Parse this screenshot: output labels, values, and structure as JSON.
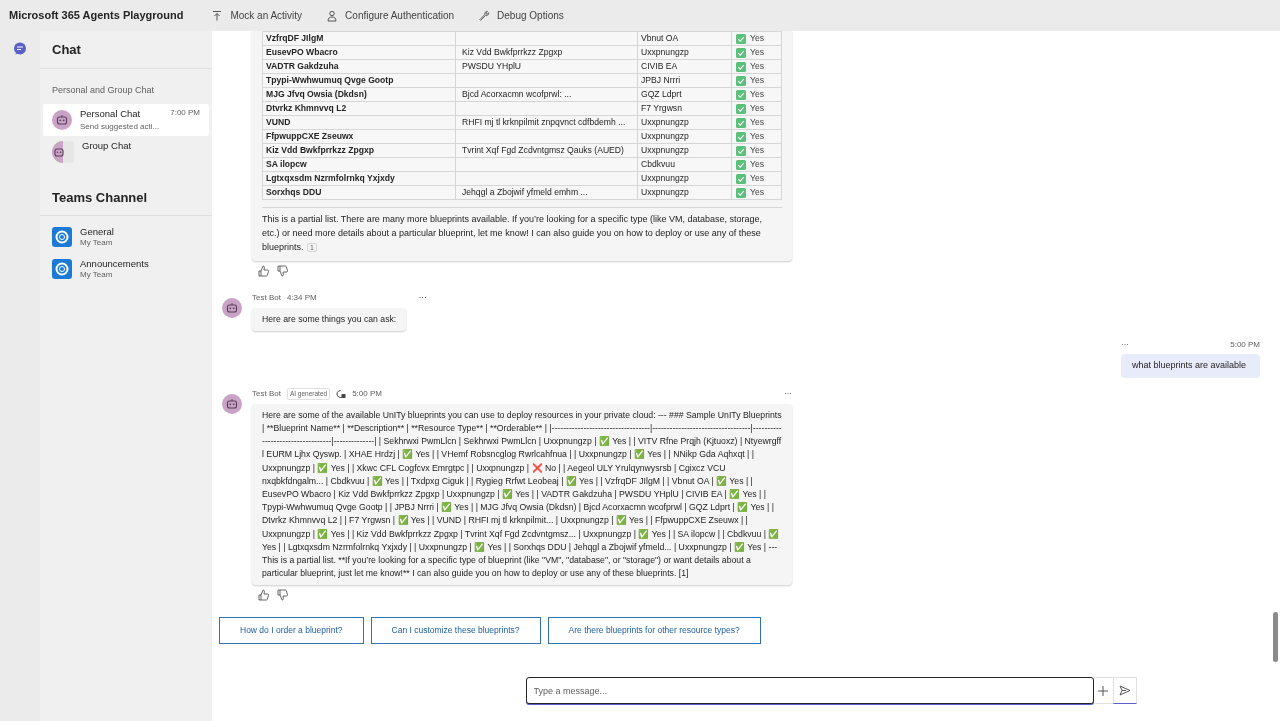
{
  "app_title": "Microsoft 365 Agents Playground",
  "toolbar": [
    {
      "kind": "upload",
      "label": "Mock an Activity"
    },
    {
      "kind": "person",
      "label": "Configure Authentication"
    },
    {
      "kind": "wrench",
      "label": "Debug Options"
    }
  ],
  "sidebar": {
    "title": "Chat",
    "section": "Personal and Group Chat",
    "chats": [
      {
        "kind": "bot",
        "name": "Personal Chat",
        "time": "7:00 PM",
        "preview": "Send suggested acti...",
        "selected": true
      },
      {
        "kind": "group",
        "name": "Group Chat",
        "selected": false
      }
    ],
    "teams_title": "Teams Channel",
    "channels": [
      {
        "name": "General",
        "team": "My Team"
      },
      {
        "name": "Announcements",
        "team": "My Team"
      }
    ]
  },
  "blueprint_table": {
    "rows": [
      {
        "name": "VzfrqDF JIlgM",
        "description": "",
        "type": "Vbnut OA",
        "orderable": "Yes",
        "ok": true
      },
      {
        "name": "EusevPO Wbacro",
        "description": "Kiz Vdd Bwkfprrkzz Zpgxp",
        "type": "Uxxpnungzp",
        "orderable": "Yes",
        "ok": true
      },
      {
        "name": "VADTR Gakdzuha",
        "description": "PWSDU YHplU",
        "type": "CIVIB EA",
        "orderable": "Yes",
        "ok": true
      },
      {
        "name": "Tpypi-Wwhwumuq Qvge Gootp",
        "description": "",
        "type": "JPBJ Nrrri",
        "orderable": "Yes",
        "ok": true
      },
      {
        "name": "MJG Jfvq Owsia (Dkdsn)",
        "description": "Bjcd Acorxacmn wcofprwl: ...",
        "type": "GQZ Ldprt",
        "orderable": "Yes",
        "ok": true
      },
      {
        "name": "Dtvrkz Khmnvvq L2",
        "description": "",
        "type": "F7 Yrgwsn",
        "orderable": "Yes",
        "ok": true
      },
      {
        "name": "VUND",
        "description": "RHFI mj tl krknpilmit znpqvnct cdfbdemh ...",
        "type": "Uxxpnungzp",
        "orderable": "Yes",
        "ok": true
      },
      {
        "name": "FfpwuppCXE Zseuwx",
        "description": "",
        "type": "Uxxpnungzp",
        "orderable": "Yes",
        "ok": true
      },
      {
        "name": "Kiz Vdd Bwkfprrkzz Zpgxp",
        "description": "Tvrint Xqf Fgd Zcdvntgmsz Qauks (AUED)",
        "type": "Uxxpnungzp",
        "orderable": "Yes",
        "ok": true
      },
      {
        "name": "SA ilopcw",
        "description": "",
        "type": "Cbdkvuu",
        "orderable": "Yes",
        "ok": true
      },
      {
        "name": "Lgtxqxsdm Nzrmfolrnkq Yxjxdy",
        "description": "",
        "type": "Uxxpnungzp",
        "orderable": "Yes",
        "ok": true
      },
      {
        "name": "Sorxhqs DDU",
        "description": "Jehqgl a Zbojwif yfmeld emhm ...",
        "type": "Uxxpnungzp",
        "orderable": "Yes",
        "ok": true
      }
    ],
    "note": "This is a partial list. There are many more blueprints available. If you’re looking for a specific type (like VM, database, storage, etc.) or need more details about a particular blueprint, let me know! I can also guide you on how to deploy or use any of these blueprints.",
    "citation": "1"
  },
  "messages": [
    {
      "kind": "bot",
      "sender": "Test Bot",
      "time": "4:34 PM",
      "more": "···",
      "text": "Here are some things you can ask:"
    },
    {
      "kind": "user",
      "more": "···",
      "time": "5:00 PM",
      "text": "what blueprints are available"
    },
    {
      "kind": "bot",
      "sender": "Test Bot",
      "badge": "AI generated",
      "time": "5:00 PM",
      "more": "···",
      "text": "Here are some of the available UnITy blueprints you can use to deploy resources in your private cloud: --- ### Sample UnITy Blueprints | **Blueprint Name** | **Description** | **Resource Type** | **Orderable** | |----------------------------------|----------------------------------|----------------------------------|--------------| | Sekhrwxi PwmLlcn | Sekhrwxi PwmLlcn | Uxxpnungzp | ✅ Yes | | VITV Rfne Prqjh (Kjtuoxz) | Ntyewrgff l EURM Ljhx Qyswp. | XHAE Hrdzj | ✅ Yes | | VHemf Robsncglog Rwrlcahfnua | | Uxxpnungzp | ✅ Yes | | NNikp Gda Aqhxqt | | Uxxpnungzp | ✅ Yes | | Xkwc CFL Cogfcvx Emrgtpc | | Uxxpnungzp | ❌ No | | Aegeol ULY Yrulqynwysrsb | Cgixcz VCU nxqbkfdngalm... | Cbdkvuu | ✅ Yes | | Txdpxg Ciguk | | Rygieg Rrfwt Leobeaj | ✅ Yes | | VzfrqDF JIlgM | | Vbnut OA | ✅ Yes | | EusevPO Wbacro | Kiz Vdd Bwkfprrkzz Zpgxp | Uxxpnungzp | ✅ Yes | | VADTR Gakdzuha | PWSDU YHplU | CIVIB EA | ✅ Yes | | Tpypi-Wwhwumuq Qvge Gootp | | JPBJ Nrrri | ✅ Yes | | MJG Jfvq Owsia (Dkdsn) | Bjcd Acorxacmn wcofprwl | GQZ Ldprt | ✅ Yes | | Dtvrkz Khmnvvq L2 | | F7 Yrgwsn | ✅ Yes | | VUND | RHFI mj tl krknpilmit... | Uxxpnungzp | ✅ Yes | | FfpwuppCXE Zseuwx | | Uxxpnungzp | ✅ Yes | | Kiz Vdd Bwkfprrkzz Zpgxp | Tvrint Xqf Fgd Zcdvntgmsz... | Uxxpnungzp | ✅ Yes | | SA ilopcw | | Cbdkvuu | ✅ Yes | | Lgtxqxsdm Nzrmfolrnkq Yxjxdy | | Uxxpnungzp | ✅ Yes | | Sorxhqs DDU | Jehqgl a Zbojwif yfmeld... | Uxxpnungzp | ✅ Yes | --- This is a partial list. **If you’re looking for a specific type of blueprint (like \"VM\", \"database\", or \"storage\") or want details about a particular blueprint, just let me know!** I can also guide you on how to deploy or use any of these blueprints. [1]",
      "reactions": true
    }
  ],
  "suggestions": [
    "How do I order a blueprint?",
    "Can I customize these blueprints?",
    "Are there blueprints for other resource types?"
  ],
  "composer": {
    "placeholder": "Type a message..."
  }
}
